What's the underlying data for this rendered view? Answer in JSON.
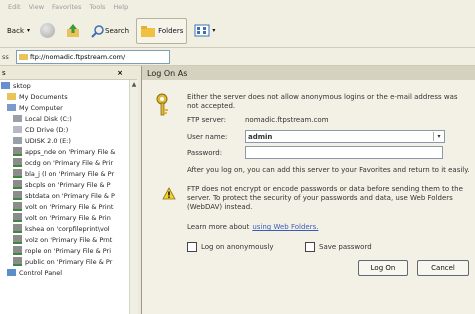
{
  "menubar": {
    "items": [
      "Edit",
      "View",
      "Favorites",
      "Tools",
      "Help"
    ]
  },
  "toolbar": {
    "back_label": "Back",
    "search_label": "Search",
    "folders_label": "Folders"
  },
  "address": {
    "label": "ss",
    "value": "ftp://nomadic.ftpstream.com/"
  },
  "folders_pane": {
    "title": "s",
    "close": "×"
  },
  "tree": {
    "items": [
      {
        "label": "sktop",
        "icon": "desktop-icon",
        "indent": 0
      },
      {
        "label": "My Documents",
        "icon": "folder-icon",
        "indent": 1
      },
      {
        "label": "My Computer",
        "icon": "computer-icon",
        "indent": 1
      },
      {
        "label": "Local Disk (C:)",
        "icon": "drive-icon",
        "indent": 2
      },
      {
        "label": "CD Drive (D:)",
        "icon": "cd-drive-icon",
        "indent": 2
      },
      {
        "label": "UDISK 2.0 (E:)",
        "icon": "drive-icon",
        "indent": 2
      },
      {
        "label": "apps_nde on 'Primary File &",
        "icon": "network-drive-icon",
        "indent": 2
      },
      {
        "label": "ocdg on 'Primary File & Prir",
        "icon": "network-drive-icon",
        "indent": 2
      },
      {
        "label": "bla_j (l on 'Primary File & Pr",
        "icon": "network-drive-icon",
        "indent": 2
      },
      {
        "label": "sbcpls on 'Primary File & P",
        "icon": "network-drive-icon",
        "indent": 2
      },
      {
        "label": "sbtdata on 'Primary File & P",
        "icon": "network-drive-icon",
        "indent": 2
      },
      {
        "label": "volt on 'Primary File & Print",
        "icon": "network-drive-icon",
        "indent": 2
      },
      {
        "label": "volt on 'Primary File & Prin",
        "icon": "network-drive-icon",
        "indent": 2
      },
      {
        "label": "kshea on 'corpfileprint\\vol",
        "icon": "network-drive-icon",
        "indent": 2
      },
      {
        "label": "volz on 'Primary File & Prnt",
        "icon": "network-drive-icon",
        "indent": 2
      },
      {
        "label": "rople on 'Primary File & Pri",
        "icon": "network-drive-icon",
        "indent": 2
      },
      {
        "label": "public on 'Primary File & Pr",
        "icon": "network-drive-icon",
        "indent": 2
      },
      {
        "label": "Control Panel",
        "icon": "control-panel-icon",
        "indent": 1
      }
    ]
  },
  "dialog": {
    "title": "Log On As",
    "intro": "Either the server does not allow anonymous logins or the e-mail address was not accepted.",
    "ftp_server_label": "FTP server:",
    "ftp_server_value": "nomadic.ftpstream.com",
    "user_name_label": "User name:",
    "user_name_value": "admin",
    "password_label": "Password:",
    "password_value": "",
    "after_logon_text": "After you log on, you can add this server to your Favorites and return to it easily.",
    "warning_text": "FTP does not encrypt or encode passwords or data before sending them to the server. To protect the security of your passwords and data, use Web Folders (WebDAV) instead.",
    "learn_more_prefix": "Learn more about",
    "learn_more_link": "using Web Folders.",
    "anonymous_label": "Log on anonymously",
    "save_password_label": "Save password",
    "logon_button": "Log On",
    "cancel_button": "Cancel"
  },
  "colors": {
    "link": "#3a5cb8",
    "toolbar_bg": "#f1efe2",
    "pane_bg": "#ffffff",
    "dialog_bg": "#f3f1e6"
  }
}
